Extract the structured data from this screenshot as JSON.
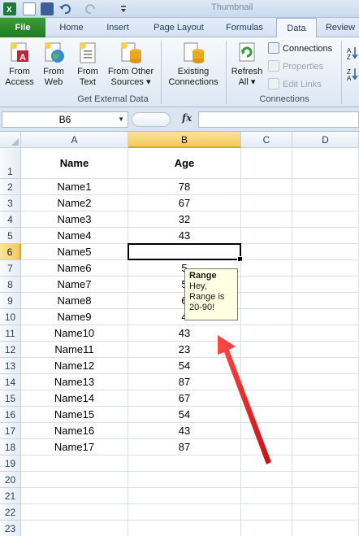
{
  "quick_access": {
    "doc_name": "Thumbnail"
  },
  "tabs": [
    {
      "label": "File"
    },
    {
      "label": "Home"
    },
    {
      "label": "Insert"
    },
    {
      "label": "Page Layout"
    },
    {
      "label": "Formulas"
    },
    {
      "label": "Data"
    },
    {
      "label": "Review"
    }
  ],
  "ribbon": {
    "get_external_data": {
      "label": "Get External Data",
      "from_access": [
        "From",
        "Access"
      ],
      "from_web": [
        "From",
        "Web"
      ],
      "from_text": [
        "From",
        "Text"
      ],
      "from_other": [
        "From Other",
        "Sources ▾"
      ],
      "existing": [
        "Existing",
        "Connections"
      ]
    },
    "connections": {
      "label": "Connections",
      "refresh": [
        "Refresh",
        "All ▾"
      ],
      "connections_cmd": "Connections",
      "properties_cmd": "Properties",
      "edit_links_cmd": "Edit Links"
    }
  },
  "formula_bar": {
    "name_box": "B6",
    "fx": "fx",
    "value": ""
  },
  "columns": [
    "A",
    "B",
    "C",
    "D"
  ],
  "rows": [
    {
      "n": "1",
      "a": "Name",
      "b": "Age"
    },
    {
      "n": "2",
      "a": "Name1",
      "b": "78"
    },
    {
      "n": "3",
      "a": "Name2",
      "b": "67"
    },
    {
      "n": "4",
      "a": "Name3",
      "b": "32"
    },
    {
      "n": "5",
      "a": "Name4",
      "b": "43"
    },
    {
      "n": "6",
      "a": "Name5",
      "b": ""
    },
    {
      "n": "7",
      "a": "Name6",
      "b": "5"
    },
    {
      "n": "8",
      "a": "Name7",
      "b": "5"
    },
    {
      "n": "9",
      "a": "Name8",
      "b": "6"
    },
    {
      "n": "10",
      "a": "Name9",
      "b": "4"
    },
    {
      "n": "11",
      "a": "Name10",
      "b": "43"
    },
    {
      "n": "12",
      "a": "Name11",
      "b": "23"
    },
    {
      "n": "13",
      "a": "Name12",
      "b": "54"
    },
    {
      "n": "14",
      "a": "Name13",
      "b": "87"
    },
    {
      "n": "15",
      "a": "Name14",
      "b": "67"
    },
    {
      "n": "16",
      "a": "Name15",
      "b": "54"
    },
    {
      "n": "17",
      "a": "Name16",
      "b": "43"
    },
    {
      "n": "18",
      "a": "Name17",
      "b": "87"
    },
    {
      "n": "19",
      "a": "",
      "b": ""
    },
    {
      "n": "20",
      "a": "",
      "b": ""
    },
    {
      "n": "21",
      "a": "",
      "b": ""
    },
    {
      "n": "22",
      "a": "",
      "b": ""
    },
    {
      "n": "23",
      "a": "",
      "b": ""
    }
  ],
  "input_message": {
    "title": "Range",
    "body": "Hey, Range is 20-90!"
  },
  "colors": {
    "file_tab": "#2a8a2a",
    "selection_header": "#f3c95b",
    "arrow": "#e8262a",
    "tooltip_bg": "#ffffe1"
  }
}
